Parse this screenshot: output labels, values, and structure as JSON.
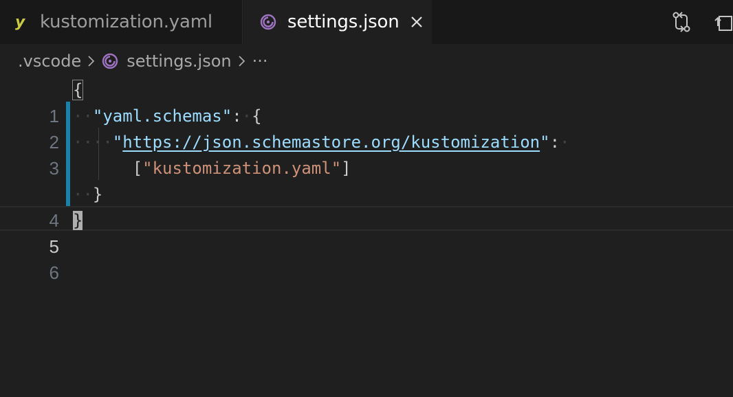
{
  "tabs": [
    {
      "label": "kustomization.yaml",
      "icon": "yaml-icon",
      "active": false
    },
    {
      "label": "settings.json",
      "icon": "json-icon",
      "active": true
    }
  ],
  "breadcrumb": {
    "folder": ".vscode",
    "file": "settings.json",
    "more": "···"
  },
  "editor": {
    "line_numbers": [
      "1",
      "2",
      "3",
      "",
      "4",
      "5",
      "6"
    ],
    "lines": {
      "l1": {
        "brace": "{"
      },
      "l2": {
        "key": "\"yaml.schemas\"",
        "colon": ":",
        "brace": "{"
      },
      "l3": {
        "quote_open": "\"",
        "url": "https://json.schemastore.org/kustomization",
        "quote_close": "\"",
        "colon": ":"
      },
      "l3b": {
        "open": "[",
        "str": "\"kustomization.yaml\"",
        "close": "]"
      },
      "l4": {
        "brace": "}"
      },
      "l5": {
        "brace": "}"
      }
    }
  },
  "colors": {
    "key": "#9cdcfe",
    "string": "#ce9178",
    "gutter_modified": "#1b81a8",
    "json_icon": "#a074c4",
    "yaml_icon": "#cbcb41"
  }
}
